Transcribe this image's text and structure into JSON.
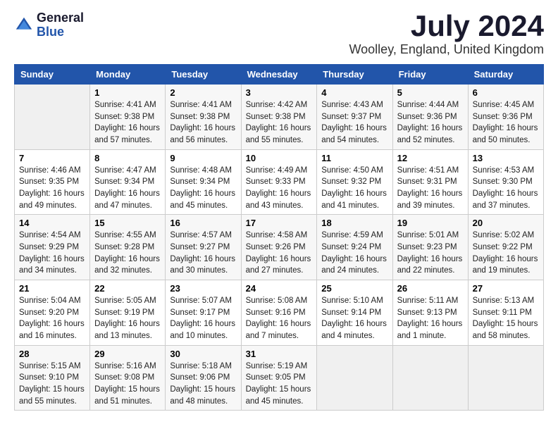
{
  "header": {
    "logo_general": "General",
    "logo_blue": "Blue",
    "month_title": "July 2024",
    "location": "Woolley, England, United Kingdom"
  },
  "weekdays": [
    "Sunday",
    "Monday",
    "Tuesday",
    "Wednesday",
    "Thursday",
    "Friday",
    "Saturday"
  ],
  "weeks": [
    [
      {
        "num": "",
        "sunrise": "",
        "sunset": "",
        "daylight": ""
      },
      {
        "num": "1",
        "sunrise": "Sunrise: 4:41 AM",
        "sunset": "Sunset: 9:38 PM",
        "daylight": "Daylight: 16 hours and 57 minutes."
      },
      {
        "num": "2",
        "sunrise": "Sunrise: 4:41 AM",
        "sunset": "Sunset: 9:38 PM",
        "daylight": "Daylight: 16 hours and 56 minutes."
      },
      {
        "num": "3",
        "sunrise": "Sunrise: 4:42 AM",
        "sunset": "Sunset: 9:38 PM",
        "daylight": "Daylight: 16 hours and 55 minutes."
      },
      {
        "num": "4",
        "sunrise": "Sunrise: 4:43 AM",
        "sunset": "Sunset: 9:37 PM",
        "daylight": "Daylight: 16 hours and 54 minutes."
      },
      {
        "num": "5",
        "sunrise": "Sunrise: 4:44 AM",
        "sunset": "Sunset: 9:36 PM",
        "daylight": "Daylight: 16 hours and 52 minutes."
      },
      {
        "num": "6",
        "sunrise": "Sunrise: 4:45 AM",
        "sunset": "Sunset: 9:36 PM",
        "daylight": "Daylight: 16 hours and 50 minutes."
      }
    ],
    [
      {
        "num": "7",
        "sunrise": "Sunrise: 4:46 AM",
        "sunset": "Sunset: 9:35 PM",
        "daylight": "Daylight: 16 hours and 49 minutes."
      },
      {
        "num": "8",
        "sunrise": "Sunrise: 4:47 AM",
        "sunset": "Sunset: 9:34 PM",
        "daylight": "Daylight: 16 hours and 47 minutes."
      },
      {
        "num": "9",
        "sunrise": "Sunrise: 4:48 AM",
        "sunset": "Sunset: 9:34 PM",
        "daylight": "Daylight: 16 hours and 45 minutes."
      },
      {
        "num": "10",
        "sunrise": "Sunrise: 4:49 AM",
        "sunset": "Sunset: 9:33 PM",
        "daylight": "Daylight: 16 hours and 43 minutes."
      },
      {
        "num": "11",
        "sunrise": "Sunrise: 4:50 AM",
        "sunset": "Sunset: 9:32 PM",
        "daylight": "Daylight: 16 hours and 41 minutes."
      },
      {
        "num": "12",
        "sunrise": "Sunrise: 4:51 AM",
        "sunset": "Sunset: 9:31 PM",
        "daylight": "Daylight: 16 hours and 39 minutes."
      },
      {
        "num": "13",
        "sunrise": "Sunrise: 4:53 AM",
        "sunset": "Sunset: 9:30 PM",
        "daylight": "Daylight: 16 hours and 37 minutes."
      }
    ],
    [
      {
        "num": "14",
        "sunrise": "Sunrise: 4:54 AM",
        "sunset": "Sunset: 9:29 PM",
        "daylight": "Daylight: 16 hours and 34 minutes."
      },
      {
        "num": "15",
        "sunrise": "Sunrise: 4:55 AM",
        "sunset": "Sunset: 9:28 PM",
        "daylight": "Daylight: 16 hours and 32 minutes."
      },
      {
        "num": "16",
        "sunrise": "Sunrise: 4:57 AM",
        "sunset": "Sunset: 9:27 PM",
        "daylight": "Daylight: 16 hours and 30 minutes."
      },
      {
        "num": "17",
        "sunrise": "Sunrise: 4:58 AM",
        "sunset": "Sunset: 9:26 PM",
        "daylight": "Daylight: 16 hours and 27 minutes."
      },
      {
        "num": "18",
        "sunrise": "Sunrise: 4:59 AM",
        "sunset": "Sunset: 9:24 PM",
        "daylight": "Daylight: 16 hours and 24 minutes."
      },
      {
        "num": "19",
        "sunrise": "Sunrise: 5:01 AM",
        "sunset": "Sunset: 9:23 PM",
        "daylight": "Daylight: 16 hours and 22 minutes."
      },
      {
        "num": "20",
        "sunrise": "Sunrise: 5:02 AM",
        "sunset": "Sunset: 9:22 PM",
        "daylight": "Daylight: 16 hours and 19 minutes."
      }
    ],
    [
      {
        "num": "21",
        "sunrise": "Sunrise: 5:04 AM",
        "sunset": "Sunset: 9:20 PM",
        "daylight": "Daylight: 16 hours and 16 minutes."
      },
      {
        "num": "22",
        "sunrise": "Sunrise: 5:05 AM",
        "sunset": "Sunset: 9:19 PM",
        "daylight": "Daylight: 16 hours and 13 minutes."
      },
      {
        "num": "23",
        "sunrise": "Sunrise: 5:07 AM",
        "sunset": "Sunset: 9:17 PM",
        "daylight": "Daylight: 16 hours and 10 minutes."
      },
      {
        "num": "24",
        "sunrise": "Sunrise: 5:08 AM",
        "sunset": "Sunset: 9:16 PM",
        "daylight": "Daylight: 16 hours and 7 minutes."
      },
      {
        "num": "25",
        "sunrise": "Sunrise: 5:10 AM",
        "sunset": "Sunset: 9:14 PM",
        "daylight": "Daylight: 16 hours and 4 minutes."
      },
      {
        "num": "26",
        "sunrise": "Sunrise: 5:11 AM",
        "sunset": "Sunset: 9:13 PM",
        "daylight": "Daylight: 16 hours and 1 minute."
      },
      {
        "num": "27",
        "sunrise": "Sunrise: 5:13 AM",
        "sunset": "Sunset: 9:11 PM",
        "daylight": "Daylight: 15 hours and 58 minutes."
      }
    ],
    [
      {
        "num": "28",
        "sunrise": "Sunrise: 5:15 AM",
        "sunset": "Sunset: 9:10 PM",
        "daylight": "Daylight: 15 hours and 55 minutes."
      },
      {
        "num": "29",
        "sunrise": "Sunrise: 5:16 AM",
        "sunset": "Sunset: 9:08 PM",
        "daylight": "Daylight: 15 hours and 51 minutes."
      },
      {
        "num": "30",
        "sunrise": "Sunrise: 5:18 AM",
        "sunset": "Sunset: 9:06 PM",
        "daylight": "Daylight: 15 hours and 48 minutes."
      },
      {
        "num": "31",
        "sunrise": "Sunrise: 5:19 AM",
        "sunset": "Sunset: 9:05 PM",
        "daylight": "Daylight: 15 hours and 45 minutes."
      },
      {
        "num": "",
        "sunrise": "",
        "sunset": "",
        "daylight": ""
      },
      {
        "num": "",
        "sunrise": "",
        "sunset": "",
        "daylight": ""
      },
      {
        "num": "",
        "sunrise": "",
        "sunset": "",
        "daylight": ""
      }
    ]
  ]
}
